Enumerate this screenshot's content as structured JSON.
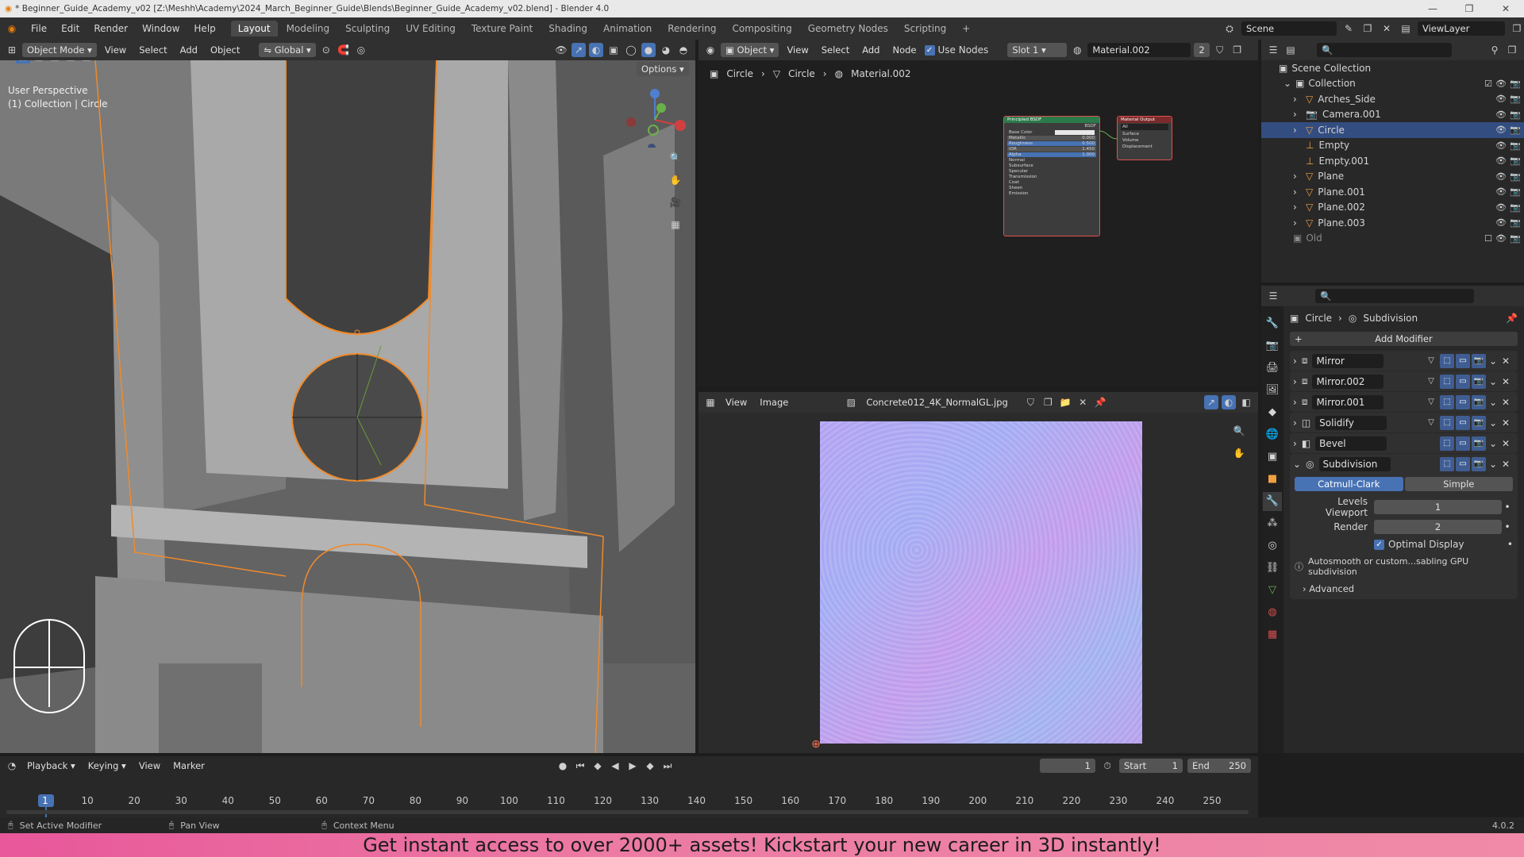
{
  "window": {
    "title": "* Beginner_Guide_Academy_v02 [Z:\\Meshh\\Academy\\2024_March_Beginner_Guide\\Blends\\Beginner_Guide_Academy_v02.blend] - Blender 4.0",
    "controls": [
      "—",
      "❐",
      "✕"
    ]
  },
  "menubar": {
    "menus": [
      "File",
      "Edit",
      "Render",
      "Window",
      "Help"
    ],
    "workspaces": [
      "Layout",
      "Modeling",
      "Sculpting",
      "UV Editing",
      "Texture Paint",
      "Shading",
      "Animation",
      "Rendering",
      "Compositing",
      "Geometry Nodes",
      "Scripting"
    ],
    "active_workspace": "Layout",
    "add_workspace": "+",
    "scene": "Scene",
    "view_layer": "ViewLayer"
  },
  "viewport": {
    "mode": "Object Mode",
    "menus": [
      "View",
      "Select",
      "Add",
      "Object"
    ],
    "transform_orientation": "Global",
    "options_label": "Options",
    "overlay_text_1": "User Perspective",
    "overlay_text_2": "(1) Collection | Circle"
  },
  "node_editor": {
    "object_type": "Object",
    "menus": [
      "View",
      "Select",
      "Add",
      "Node"
    ],
    "use_nodes_label": "Use Nodes",
    "slot": "Slot 1",
    "material": "Material.002",
    "users": "2",
    "breadcrumb": [
      "Circle",
      "Circle",
      "Material.002"
    ],
    "bsdf_title": "Principled BSDF",
    "bsdf_out": "BSDF",
    "bsdf_rows": [
      {
        "label": "Base Color",
        "value": ""
      },
      {
        "label": "Metallic",
        "value": "0.000"
      },
      {
        "label": "Roughness",
        "value": "0.500"
      },
      {
        "label": "IOR",
        "value": "1.450"
      },
      {
        "label": "Alpha",
        "value": "1.000"
      },
      {
        "label": "Normal",
        "value": ""
      },
      {
        "label": "Subsurface",
        "value": ""
      },
      {
        "label": "Specular",
        "value": ""
      },
      {
        "label": "Transmission",
        "value": ""
      },
      {
        "label": "Coat",
        "value": ""
      },
      {
        "label": "Sheen",
        "value": ""
      },
      {
        "label": "Emission",
        "value": ""
      }
    ],
    "output_title": "Material Output",
    "output_target": "All",
    "output_rows": [
      "Surface",
      "Volume",
      "Displacement"
    ]
  },
  "image_editor": {
    "menus": [
      "View",
      "Image"
    ],
    "image_name": "Concrete012_4K_NormalGL.jpg"
  },
  "outliner": {
    "root": "Scene Collection",
    "collection": "Collection",
    "items": [
      {
        "name": "Arches_Side",
        "selected": false
      },
      {
        "name": "Camera.001",
        "selected": false
      },
      {
        "name": "Circle",
        "selected": true
      },
      {
        "name": "Empty",
        "selected": false
      },
      {
        "name": "Empty.001",
        "selected": false
      },
      {
        "name": "Plane",
        "selected": false
      },
      {
        "name": "Plane.001",
        "selected": false
      },
      {
        "name": "Plane.002",
        "selected": false
      },
      {
        "name": "Plane.003",
        "selected": false
      }
    ],
    "old_collection": "Old"
  },
  "properties": {
    "breadcrumb_object": "Circle",
    "breadcrumb_modifier": "Subdivision",
    "add_modifier": "Add Modifier",
    "modifiers": [
      "Mirror",
      "Mirror.002",
      "Mirror.001",
      "Solidify",
      "Bevel",
      "Subdivision"
    ],
    "subdiv_types": [
      "Catmull-Clark",
      "Simple"
    ],
    "levels_viewport_label": "Levels Viewport",
    "levels_viewport": "1",
    "render_label": "Render",
    "render_levels": "2",
    "optimal_display": "Optimal Display",
    "info": "Autosmooth or custom...sabling GPU subdivision",
    "advanced": "Advanced"
  },
  "timeline": {
    "menus": [
      "Playback",
      "Keying",
      "View",
      "Marker"
    ],
    "current_frame": "1",
    "start_label": "Start",
    "start": "1",
    "end_label": "End",
    "end": "250",
    "ticks": [
      "1",
      "10",
      "20",
      "30",
      "40",
      "50",
      "60",
      "70",
      "80",
      "90",
      "100",
      "110",
      "120",
      "130",
      "140",
      "150",
      "160",
      "170",
      "180",
      "190",
      "200",
      "210",
      "220",
      "230",
      "240",
      "250"
    ]
  },
  "statusbar": {
    "items": [
      "Set Active Modifier",
      "Pan View",
      "Context Menu"
    ],
    "version": "4.0.2"
  },
  "banner": "Get instant access to over 2000+ assets! Kickstart your new career in 3D instantly!"
}
